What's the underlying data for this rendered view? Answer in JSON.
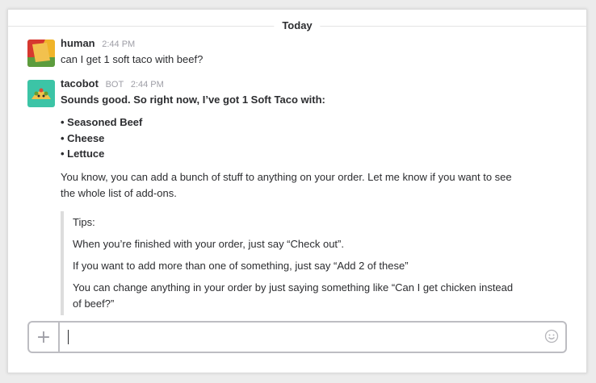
{
  "divider": {
    "label": "Today"
  },
  "messages": [
    {
      "sender": "human",
      "time": "2:44 PM",
      "text": "can I get 1 soft taco with beef?"
    },
    {
      "sender": "tacobot",
      "badge": "BOT",
      "time": "2:44 PM",
      "intro": "Sounds good. So right now, I’ve got 1 Soft Taco with:",
      "items": [
        "• Seasoned Beef",
        "• Cheese",
        "• Lettuce"
      ],
      "paragraph": "You know, you can add a bunch of stuff to anything on your order. Let me know if you want to see the whole list of add-ons.",
      "tips": {
        "title": "Tips:",
        "lines": [
          "When you’re finished with your order, just say “Check out”.",
          "If you want to add more than one of something, just say “Add 2 of these”",
          "You can change anything in your order by just saying something like “Can I get chicken instead of beef?”"
        ]
      }
    }
  ],
  "composer": {
    "value": "",
    "plus_icon": "plus-icon",
    "emoji_icon": "smiley-icon"
  }
}
